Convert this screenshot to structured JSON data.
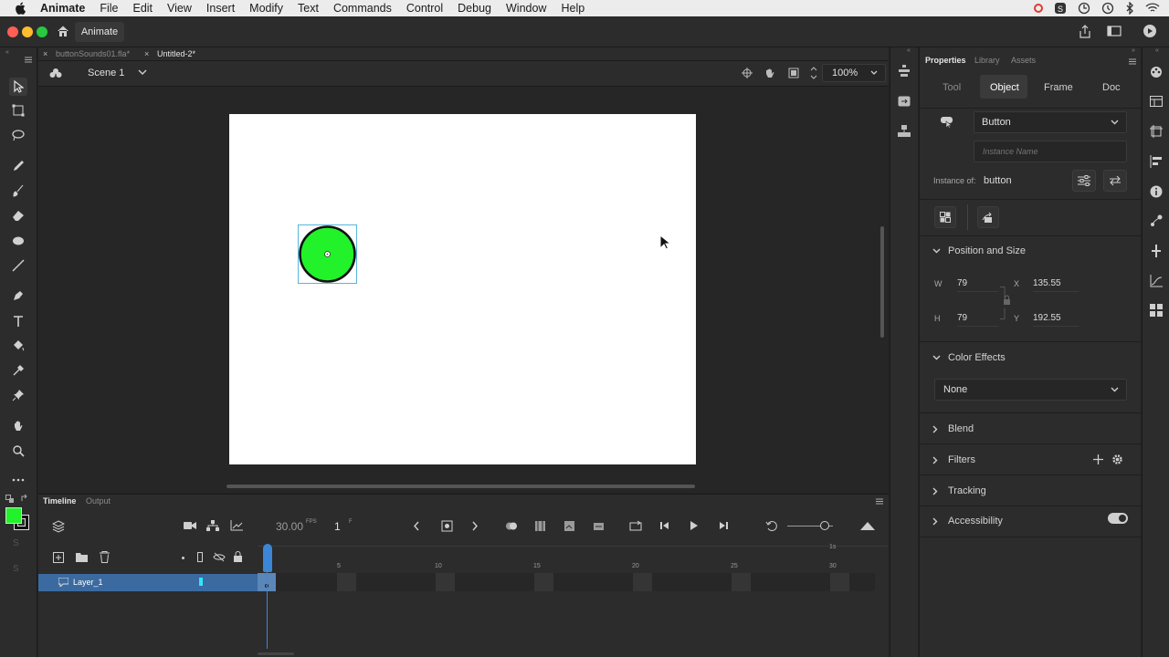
{
  "menubar": {
    "app": "Animate",
    "items": [
      "File",
      "Edit",
      "View",
      "Insert",
      "Modify",
      "Text",
      "Commands",
      "Control",
      "Debug",
      "Window",
      "Help"
    ]
  },
  "titlebar": {
    "home_label": "Animate"
  },
  "doc_tabs": [
    {
      "label": "buttonSounds01.fla*",
      "active": false
    },
    {
      "label": "Untitled-2*",
      "active": true
    }
  ],
  "edit_bar": {
    "scene": "Scene 1",
    "zoom": "100%"
  },
  "colors": {
    "fill": "#22f22a",
    "stroke": "#111111",
    "accent": "#3b86d6",
    "layer_selected": "#3b6aa0"
  },
  "timeline": {
    "tabs": [
      "Timeline",
      "Output"
    ],
    "fps": "30.00",
    "fps_unit": "FPS",
    "frame": "1",
    "frame_unit": "F",
    "seconds_marker": "1s",
    "ruler": [
      "5",
      "10",
      "15",
      "20",
      "25",
      "30"
    ],
    "layer_name": "Layer_1"
  },
  "properties": {
    "tabs": [
      "Properties",
      "Library",
      "Assets"
    ],
    "subtabs": [
      "Tool",
      "Object",
      "Frame",
      "Doc"
    ],
    "active_subtab": "Object",
    "symbol_type": "Button",
    "instance_name_placeholder": "Instance Name",
    "instance_of_label": "Instance of:",
    "instance_of": "button",
    "position_size": {
      "title": "Position and Size",
      "w_label": "W",
      "w": "79",
      "h_label": "H",
      "h": "79",
      "x_label": "X",
      "x": "135.55",
      "y_label": "Y",
      "y": "192.55"
    },
    "color_effects": {
      "title": "Color Effects",
      "value": "None"
    },
    "sections": [
      "Blend",
      "Filters",
      "Tracking",
      "Accessibility"
    ]
  }
}
